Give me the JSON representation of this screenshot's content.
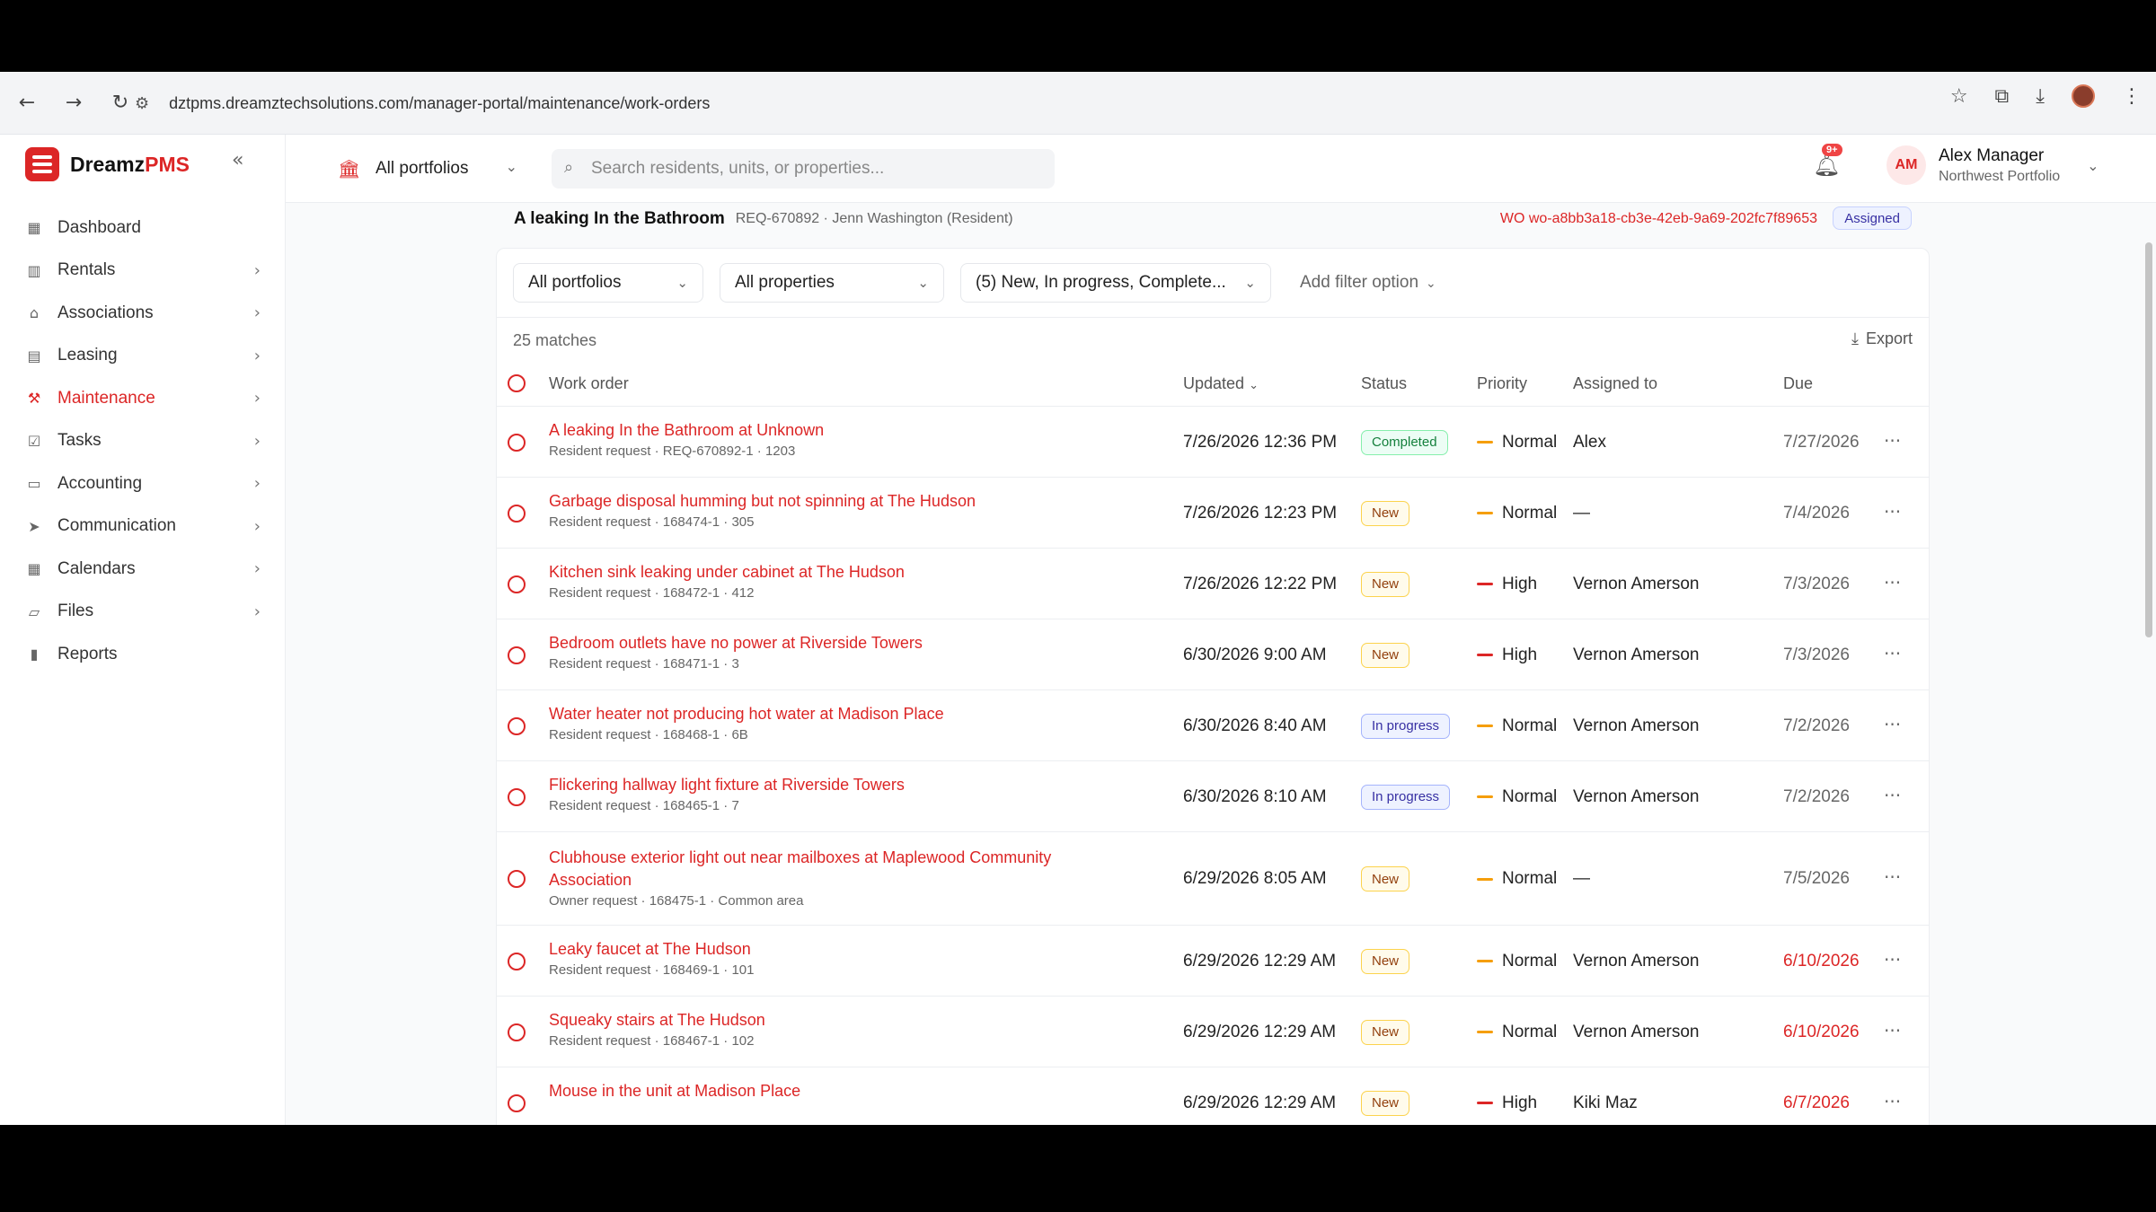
{
  "browser": {
    "url": "dztpms.dreamztechsolutions.com/manager-portal/maintenance/work-orders"
  },
  "brand": {
    "name_main": "Dreamz",
    "name_accent": "PMS",
    "accent": "#dc2626"
  },
  "sidebar": {
    "items": [
      {
        "label": "Dashboard",
        "icon": "grid-icon",
        "chevron": false,
        "active": false
      },
      {
        "label": "Rentals",
        "icon": "building-icon",
        "chevron": true,
        "active": false
      },
      {
        "label": "Associations",
        "icon": "bank-icon",
        "chevron": true,
        "active": false
      },
      {
        "label": "Leasing",
        "icon": "document-icon",
        "chevron": true,
        "active": false
      },
      {
        "label": "Maintenance",
        "icon": "wrench-icon",
        "chevron": true,
        "active": true
      },
      {
        "label": "Tasks",
        "icon": "checkbox-icon",
        "chevron": true,
        "active": false
      },
      {
        "label": "Accounting",
        "icon": "wallet-icon",
        "chevron": true,
        "active": false
      },
      {
        "label": "Communication",
        "icon": "send-icon",
        "chevron": true,
        "active": false
      },
      {
        "label": "Calendars",
        "icon": "calendar-icon",
        "chevron": true,
        "active": false
      },
      {
        "label": "Files",
        "icon": "folder-icon",
        "chevron": true,
        "active": false
      },
      {
        "label": "Reports",
        "icon": "bar-chart-icon",
        "chevron": false,
        "active": false
      }
    ]
  },
  "topbar": {
    "portfolio": "All portfolios",
    "search_placeholder": "Search residents, units, or properties...",
    "notifications_badge": "9+",
    "user_initials": "AM",
    "user_name": "Alex Manager",
    "user_portfolio": "Northwest Portfolio"
  },
  "banner": {
    "title": "A leaking In the Bathroom",
    "subtitle": "REQ-670892 · Jenn Washington (Resident)",
    "wo_id": "WO wo-a8bb3a18-cb3e-42eb-9a69-202fc7f89653",
    "status": "Assigned"
  },
  "filters": {
    "portfolios": "All portfolios",
    "properties": "All properties",
    "statuses": "(5) New, In progress, Complete...",
    "add_filter": "Add filter option"
  },
  "table": {
    "matches": "25 matches",
    "export": "Export",
    "headers": {
      "work_order": "Work order",
      "updated": "Updated",
      "status": "Status",
      "priority": "Priority",
      "assigned_to": "Assigned to",
      "due": "Due"
    },
    "rows": [
      {
        "title": "A leaking In the Bathroom at Unknown",
        "title2": "",
        "sub": "Resident request · REQ-670892-1 · 1203",
        "updated": "7/26/2026 12:36 PM",
        "status": "Completed",
        "priority": "Normal",
        "assigned": "Alex",
        "due": "7/27/2026",
        "overdue": false
      },
      {
        "title": "Garbage disposal humming but not spinning at The Hudson",
        "title2": "",
        "sub": "Resident request · 168474-1 · 305",
        "updated": "7/26/2026 12:23 PM",
        "status": "New",
        "priority": "Normal",
        "assigned": "—",
        "due": "7/4/2026",
        "overdue": false
      },
      {
        "title": "Kitchen sink leaking under cabinet at The Hudson",
        "title2": "",
        "sub": "Resident request · 168472-1 · 412",
        "updated": "7/26/2026 12:22 PM",
        "status": "New",
        "priority": "High",
        "assigned": "Vernon Amerson",
        "due": "7/3/2026",
        "overdue": false
      },
      {
        "title": "Bedroom outlets have no power at Riverside Towers",
        "title2": "",
        "sub": "Resident request · 168471-1 · 3",
        "updated": "6/30/2026 9:00 AM",
        "status": "New",
        "priority": "High",
        "assigned": "Vernon Amerson",
        "due": "7/3/2026",
        "overdue": false
      },
      {
        "title": "Water heater not producing hot water at Madison Place",
        "title2": "",
        "sub": "Resident request · 168468-1 · 6B",
        "updated": "6/30/2026 8:40 AM",
        "status": "In progress",
        "priority": "Normal",
        "assigned": "Vernon Amerson",
        "due": "7/2/2026",
        "overdue": false
      },
      {
        "title": "Flickering hallway light fixture at Riverside Towers",
        "title2": "",
        "sub": "Resident request · 168465-1 · 7",
        "updated": "6/30/2026 8:10 AM",
        "status": "In progress",
        "priority": "Normal",
        "assigned": "Vernon Amerson",
        "due": "7/2/2026",
        "overdue": false
      },
      {
        "title": "Clubhouse exterior light out near mailboxes at Maplewood Community",
        "title2": "Association",
        "sub": "Owner request · 168475-1 · Common area",
        "updated": "6/29/2026 8:05 AM",
        "status": "New",
        "priority": "Normal",
        "assigned": "—",
        "due": "7/5/2026",
        "overdue": false
      },
      {
        "title": "Leaky faucet at The Hudson",
        "title2": "",
        "sub": "Resident request · 168469-1 · 101",
        "updated": "6/29/2026 12:29 AM",
        "status": "New",
        "priority": "Normal",
        "assigned": "Vernon Amerson",
        "due": "6/10/2026",
        "overdue": true
      },
      {
        "title": "Squeaky stairs at The Hudson",
        "title2": "",
        "sub": "Resident request · 168467-1 · 102",
        "updated": "6/29/2026 12:29 AM",
        "status": "New",
        "priority": "Normal",
        "assigned": "Vernon Amerson",
        "due": "6/10/2026",
        "overdue": true
      },
      {
        "title": "Mouse in the unit at Madison Place",
        "title2": "",
        "sub": "",
        "updated": "6/29/2026 12:29 AM",
        "status": "New",
        "priority": "High",
        "assigned": "Kiki Maz",
        "due": "6/7/2026",
        "overdue": true
      }
    ]
  },
  "colors": {
    "normal_priority": "#f59e0b",
    "high_priority": "#dc2626"
  }
}
